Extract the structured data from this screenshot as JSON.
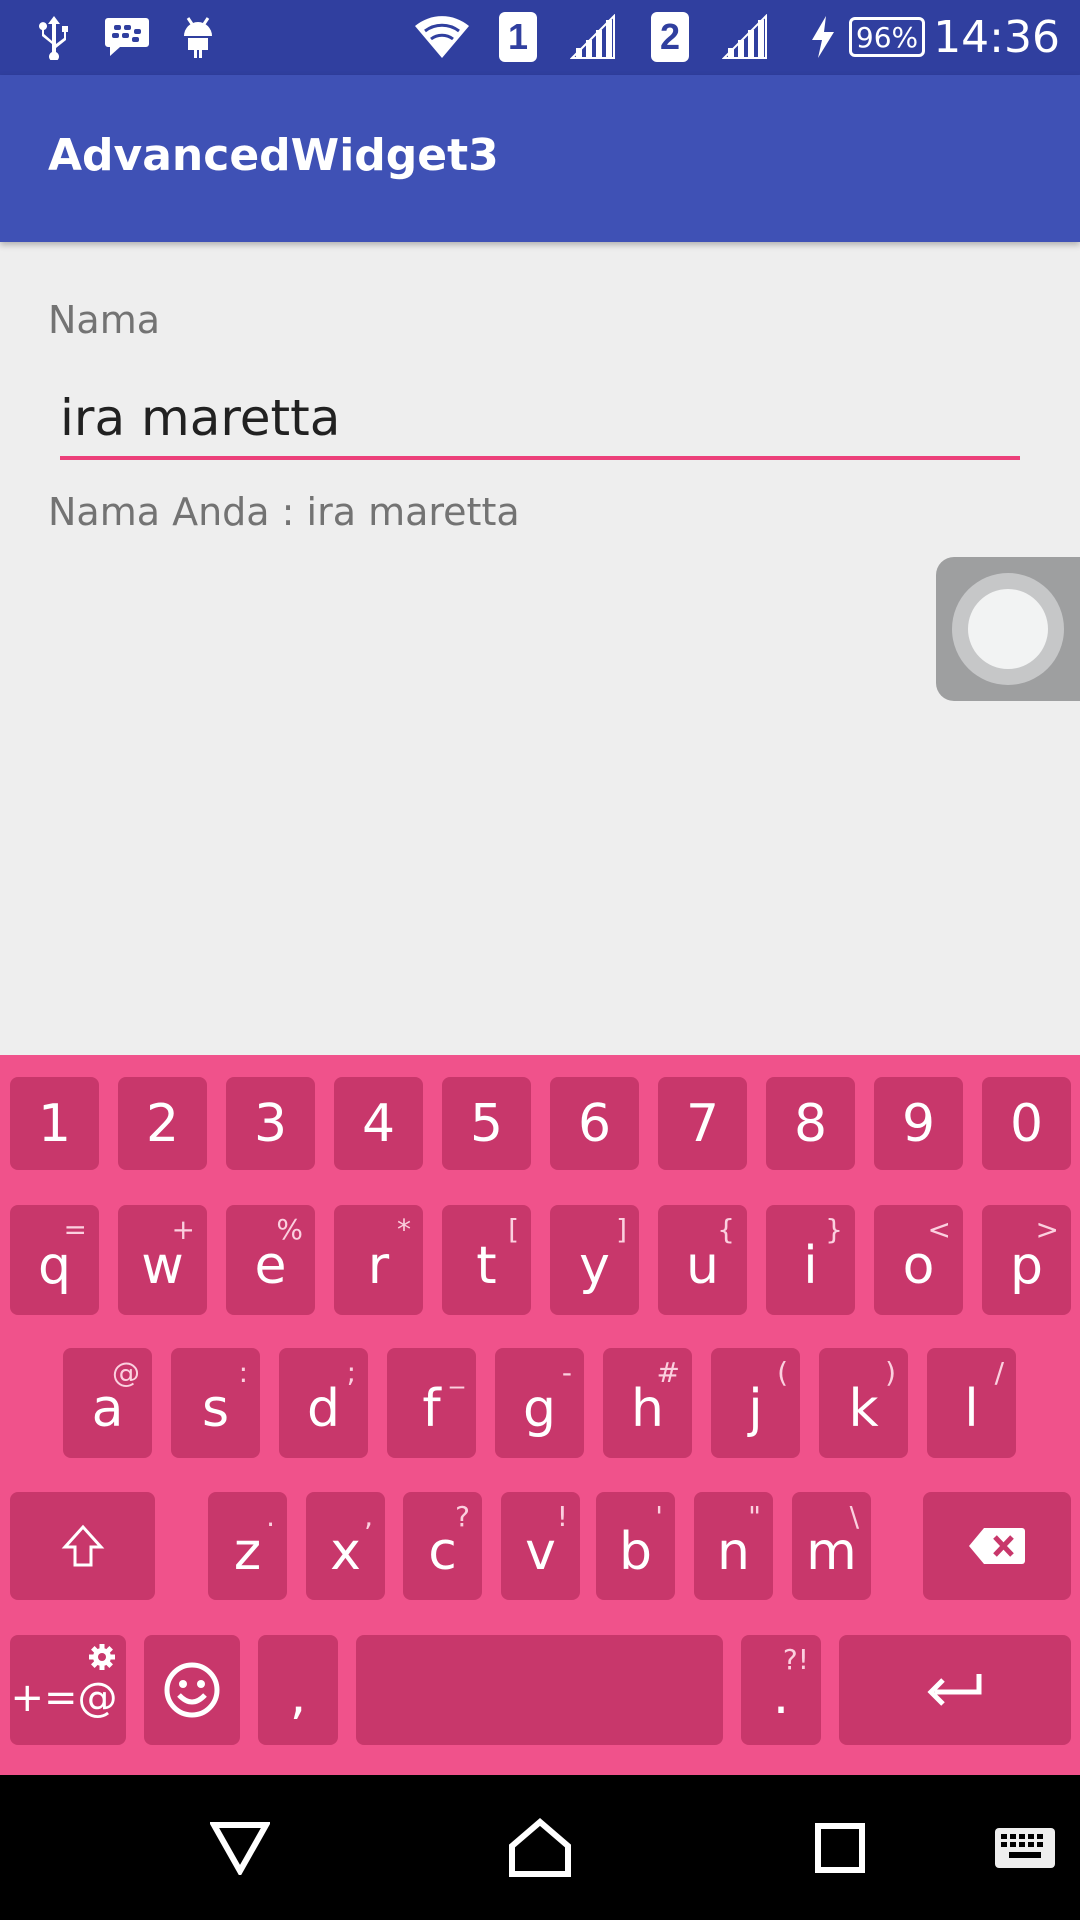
{
  "status_bar": {
    "time": "14:36",
    "battery": "96%",
    "sim1": "1",
    "sim2": "2",
    "icons": [
      "usb-icon",
      "bbm-icon",
      "android-debug-icon",
      "wifi-icon",
      "signal-icon",
      "charging-icon"
    ]
  },
  "app_bar": {
    "title": "AdvancedWidget3"
  },
  "form": {
    "label": "Nama",
    "input_value": "ira maretta",
    "output_text": "Nama Anda : ira maretta"
  },
  "keyboard": {
    "accent_color": "#f0528b",
    "key_color": "#c8376b",
    "number_row": [
      "1",
      "2",
      "3",
      "4",
      "5",
      "6",
      "7",
      "8",
      "9",
      "0"
    ],
    "row1": [
      {
        "key": "q",
        "hint": "="
      },
      {
        "key": "w",
        "hint": "+"
      },
      {
        "key": "e",
        "hint": "%"
      },
      {
        "key": "r",
        "hint": "*"
      },
      {
        "key": "t",
        "hint": "["
      },
      {
        "key": "y",
        "hint": "]"
      },
      {
        "key": "u",
        "hint": "{"
      },
      {
        "key": "i",
        "hint": "}"
      },
      {
        "key": "o",
        "hint": "<"
      },
      {
        "key": "p",
        "hint": ">"
      }
    ],
    "row2": [
      {
        "key": "a",
        "hint": "@"
      },
      {
        "key": "s",
        "hint": ":"
      },
      {
        "key": "d",
        "hint": ";"
      },
      {
        "key": "f",
        "hint": "_"
      },
      {
        "key": "g",
        "hint": "-"
      },
      {
        "key": "h",
        "hint": "#"
      },
      {
        "key": "j",
        "hint": "("
      },
      {
        "key": "k",
        "hint": ")"
      },
      {
        "key": "l",
        "hint": "/"
      }
    ],
    "row3": [
      {
        "key": "z",
        "hint": "."
      },
      {
        "key": "x",
        "hint": ","
      },
      {
        "key": "c",
        "hint": "?"
      },
      {
        "key": "v",
        "hint": "!"
      },
      {
        "key": "b",
        "hint": "'"
      },
      {
        "key": "n",
        "hint": "\""
      },
      {
        "key": "m",
        "hint": "\\"
      }
    ],
    "symbols_label": "+=@",
    "comma_label": ",",
    "period_label": ".",
    "period_hint": "?!"
  },
  "nav_bar": {
    "buttons": [
      "back-icon",
      "home-icon",
      "recents-icon",
      "keyboard-icon"
    ]
  }
}
